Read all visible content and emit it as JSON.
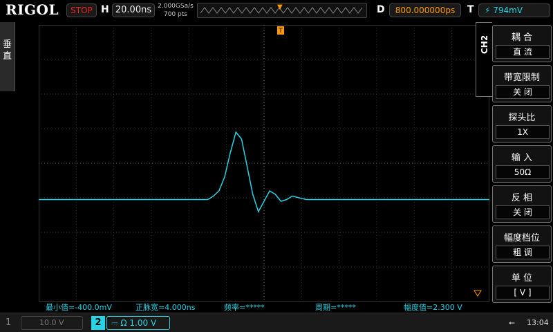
{
  "topbar": {
    "brand": "RIGOL",
    "run_state": "STOP",
    "h_label": "H",
    "timebase": "20.00ns",
    "sample_rate": "2.000GSa/s",
    "mem_depth": "700 pts",
    "d_label": "D",
    "delay": "800.000000ps",
    "t_label": "T",
    "trigger_level": "794mV",
    "trigger_icon": "rising-edge-icon"
  },
  "left_tab": {
    "label": "垂直"
  },
  "channel_tab": "CH2",
  "menu": [
    {
      "title": "耦 合",
      "value": "直 流"
    },
    {
      "title": "带宽限制",
      "value": "关 闭"
    },
    {
      "title": "探头比",
      "value": "1X"
    },
    {
      "title": "输 入",
      "value": "50Ω"
    },
    {
      "title": "反 相",
      "value": "关 闭"
    },
    {
      "title": "幅度档位",
      "value": "粗 调"
    },
    {
      "title": "单 位",
      "value": "[ V ]"
    }
  ],
  "measurements": {
    "min": "最小值=-400.0mV",
    "pos_width": "正脉宽=4.000ns",
    "freq": "频率=*****",
    "period": "周期=*****",
    "amplitude": "幅度值=2.300 V"
  },
  "bottom": {
    "ch1_num": "1",
    "ch1_scale": "10.0 V",
    "ch2_num": "2",
    "ch2_scale": "1.00 V",
    "ch2_imp_symbol": "Ω",
    "time": "13:04"
  },
  "colors": {
    "ch2": "#26d4e6",
    "trigger": "#ff9900",
    "stop": "#e22222"
  },
  "chart_data": {
    "type": "line",
    "series": [
      {
        "x": [
          0,
          10,
          20,
          30,
          40,
          50,
          60,
          62,
          64,
          66,
          68,
          70,
          72,
          74,
          76,
          78,
          80,
          82,
          84,
          86,
          88,
          90,
          95,
          100,
          110,
          120,
          130,
          140,
          150,
          160
        ],
        "y": [
          -0.05,
          -0.05,
          -0.05,
          -0.05,
          -0.05,
          -0.05,
          -0.05,
          0.05,
          0.2,
          0.6,
          1.3,
          1.9,
          1.7,
          0.9,
          0.1,
          -0.4,
          -0.1,
          0.2,
          0.1,
          -0.1,
          -0.05,
          0.05,
          -0.05,
          -0.05,
          -0.05,
          -0.05,
          -0.05,
          -0.05,
          -0.05,
          -0.05
        ]
      }
    ],
    "xlim": [
      0,
      160
    ],
    "ylim": [
      -3,
      5
    ],
    "grid": true
  }
}
